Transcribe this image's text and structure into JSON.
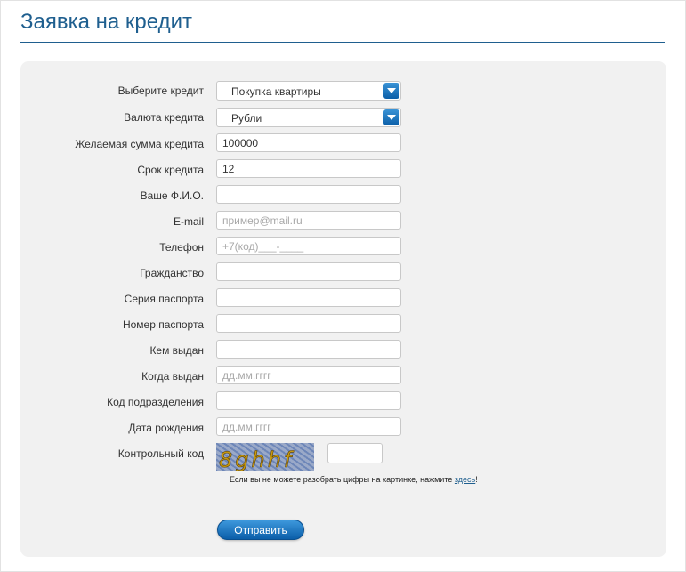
{
  "page": {
    "title": "Заявка на кредит"
  },
  "form": {
    "credit_type": {
      "label": "Выберите кредит",
      "value": "Покупка квартиры"
    },
    "currency": {
      "label": "Валюта кредита",
      "value": "Рубли"
    },
    "amount": {
      "label": "Желаемая сумма кредита",
      "value": "100000"
    },
    "term": {
      "label": "Срок кредита",
      "value": "12"
    },
    "full_name": {
      "label": "Ваше Ф.И.О.",
      "value": ""
    },
    "email": {
      "label": "E-mail",
      "placeholder": "пример@mail.ru"
    },
    "phone": {
      "label": "Телефон",
      "placeholder": "+7(код)___-____"
    },
    "citizenship": {
      "label": "Гражданство",
      "value": ""
    },
    "passport_series": {
      "label": "Серия паспорта",
      "value": ""
    },
    "passport_number": {
      "label": "Номер паспорта",
      "value": ""
    },
    "issued_by": {
      "label": "Кем выдан",
      "value": ""
    },
    "issue_date": {
      "label": "Когда выдан",
      "placeholder": "дд.мм.гггг"
    },
    "division_code": {
      "label": "Код подразделения",
      "value": ""
    },
    "birth_date": {
      "label": "Дата рождения",
      "placeholder": "дд.мм.гггг"
    },
    "captcha": {
      "label": "Контрольный код",
      "image_text": "8ghhf",
      "hint_prefix": "Если вы не можете разобрать цифры на картинке, нажмите ",
      "hint_link": "здесь",
      "hint_suffix": "!"
    },
    "submit_label": "Отправить"
  },
  "colors": {
    "accent": "#1f5f8f",
    "button": "#0b5ea9",
    "panel": "#f1f1f1"
  },
  "icons": {
    "dropdown": "chevron-down-icon"
  }
}
